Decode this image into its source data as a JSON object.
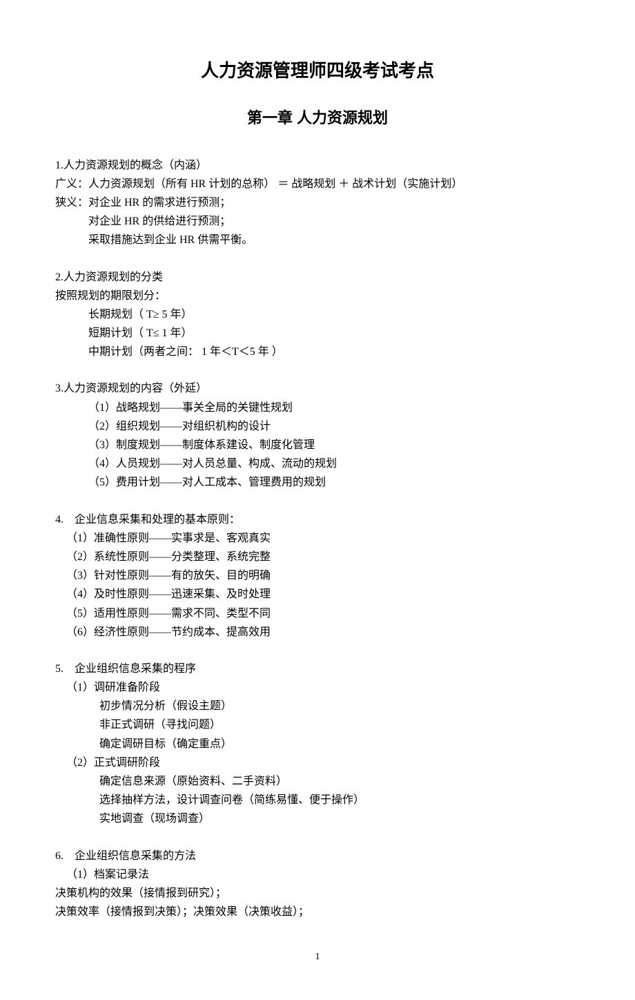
{
  "doc_title": "人力资源管理师四级考试考点",
  "doc_subtitle": "第一章 人力资源规划",
  "sections": [
    {
      "heading": "1.人力资源规划的概念（内涵）",
      "lines": [
        {
          "text": "广义：人力资源规划（所有 HR 计划的总称） ＝ 战略规划 ＋ 战术计划（实施计划）",
          "indent": "none"
        },
        {
          "text": "狭义：对企业 HR 的需求进行预测；",
          "indent": "none"
        },
        {
          "text": "对企业 HR 的供给进行预测；",
          "indent": "indent1"
        },
        {
          "text": "采取措施达到企业 HR 供需平衡。",
          "indent": "indent1"
        }
      ]
    },
    {
      "heading": "2.人力资源规划的分类",
      "lines": [
        {
          "text": "按照规划的期限划分：",
          "indent": "none"
        },
        {
          "text": "长期规划（ T≥ 5 年）",
          "indent": "indent1"
        },
        {
          "text": "短期计划（ T≤ 1 年）",
          "indent": "indent1"
        },
        {
          "text": "中期计划（两者之间： 1 年＜T＜5 年 ）",
          "indent": "indent1"
        }
      ]
    },
    {
      "heading": "3.人力资源规划的内容（外延）",
      "lines": [
        {
          "text": "（1）战略规划——事关全局的关键性规划",
          "indent": "indent1"
        },
        {
          "text": "（2）组织规划——对组织机构的设计",
          "indent": "indent1"
        },
        {
          "text": "（3）制度规划——制度体系建设、制度化管理",
          "indent": "indent1"
        },
        {
          "text": "（4）人员规划——对人员总量、构成、流动的规划",
          "indent": "indent1"
        },
        {
          "text": "（5）费用计划——对人工成本、管理费用的规划",
          "indent": "indent1"
        }
      ]
    },
    {
      "heading": "4.　企业信息采集和处理的基本原则：",
      "lines": [
        {
          "text": "（1）准确性原则——实事求是、客观真实",
          "indent": "indent-small"
        },
        {
          "text": "（2）系统性原则——分类整理、系统完整",
          "indent": "indent-small"
        },
        {
          "text": "（3）针对性原则——有的放矢、目的明确",
          "indent": "indent-small"
        },
        {
          "text": "（4）及时性原则——迅速采集、及时处理",
          "indent": "indent-small"
        },
        {
          "text": "（5）适用性原则——需求不同、类型不同",
          "indent": "indent-small"
        },
        {
          "text": "（6）经济性原则——节约成本、提高效用",
          "indent": "indent-small"
        }
      ]
    },
    {
      "heading": "5.　企业组织信息采集的程序",
      "lines": [
        {
          "text": "（1）调研准备阶段",
          "indent": "indent-small"
        },
        {
          "text": "初步情况分析（假设主题）",
          "indent": "indent2"
        },
        {
          "text": "非正式调研（寻找问题）",
          "indent": "indent2"
        },
        {
          "text": "确定调研目标（确定重点）",
          "indent": "indent2"
        },
        {
          "text": "（2）正式调研阶段",
          "indent": "indent-small"
        },
        {
          "text": "确定信息来源（原始资料、二手资料）",
          "indent": "indent2"
        },
        {
          "text": "选择抽样方法，设计调查问卷（简练易懂、便于操作）",
          "indent": "indent2"
        },
        {
          "text": "实地调查（现场调查）",
          "indent": "indent2"
        }
      ]
    },
    {
      "heading": "6.　企业组织信息采集的方法",
      "lines": [
        {
          "text": "（1）档案记录法",
          "indent": "indent-small"
        },
        {
          "text": "决策机构的效果（接情报到研究）；",
          "indent": "none"
        },
        {
          "text": "决策效率（接情报到决策）；决策效果（决策收益）；",
          "indent": "none"
        }
      ]
    }
  ],
  "page_number": "1"
}
